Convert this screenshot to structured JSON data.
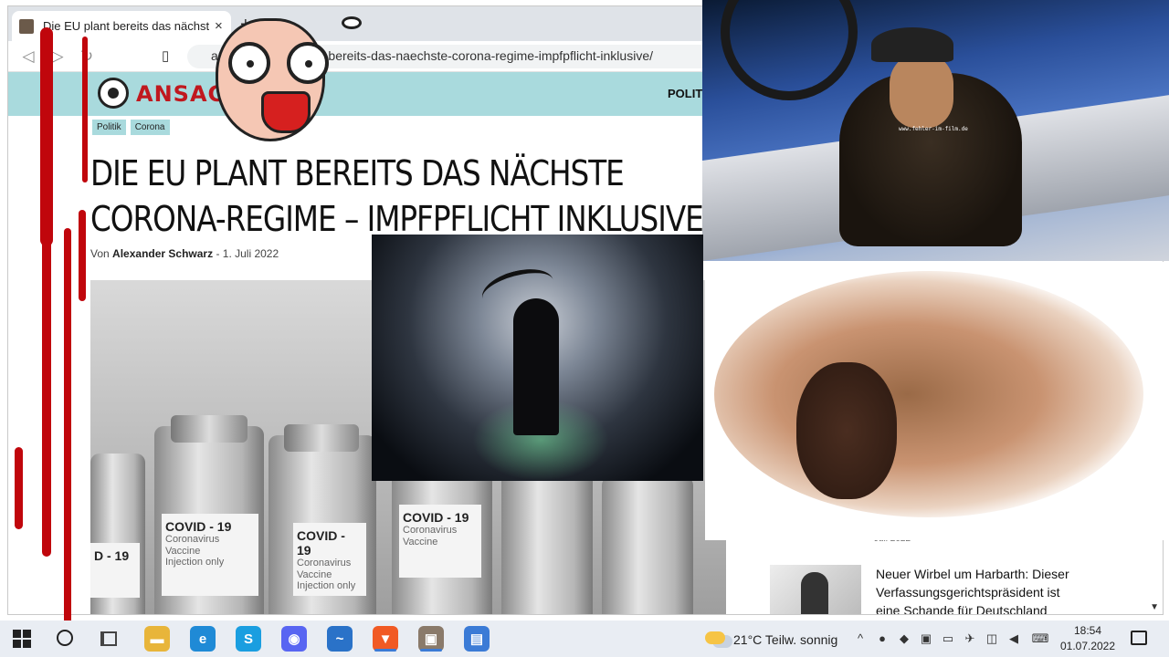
{
  "browser": {
    "tab_title": "Die EU plant bereits das nächste C",
    "new_tab": "+",
    "close": "×",
    "url": "anso...e/politik/plant-bereits-das-naechste-corona-regime-impfpflicht-inklusive/"
  },
  "site": {
    "logo_text": "ANSAGE",
    "nav_label": "POLITIK"
  },
  "article": {
    "tags": [
      "Politik",
      "Corona"
    ],
    "headline_line1": "DIE EU PLANT BEREITS DAS NÄCHSTE",
    "headline_line2": "CORONA-REGIME – IMPFPFLICHT INKLUSIVE",
    "byline_prefix": "Von",
    "author": "Alexander Schwarz",
    "date_sep": "-",
    "date": "1. Juli 2022",
    "vial_labels": [
      {
        "big": "COVID - 19",
        "small1": "Coronavirus",
        "small2": "Vaccine",
        "small3": "Injection only"
      },
      {
        "big": "COVID - 19",
        "small1": "Coronavirus",
        "small2": "Vaccine",
        "small3": "Injection only"
      },
      {
        "big": "COVID - 19",
        "small1": "Coronavirus",
        "small2": "Vaccine",
        "small3": ""
      },
      {
        "big": "D - 19",
        "small1": "",
        "small2": "",
        "small3": ""
      }
    ]
  },
  "sidebar": {
    "date_partial": "Juli 2022",
    "article_title": "Neuer Wirbel um Harbarth: Dieser Verfassungsgerichtspräsident ist eine Schande für Deutschland"
  },
  "overlays": {
    "watermark": "www.fehler-im-film.de"
  },
  "taskbar": {
    "apps": [
      {
        "icon": "file-explorer-icon",
        "color": "#e8b53a",
        "glyph": "▬"
      },
      {
        "icon": "edge-icon",
        "color": "#1f8ad6",
        "glyph": "e"
      },
      {
        "icon": "skype-icon",
        "color": "#1a9ee0",
        "glyph": "S"
      },
      {
        "icon": "discord-icon",
        "color": "#5865f2",
        "glyph": "◉"
      },
      {
        "icon": "thunderbird-icon",
        "color": "#2a72c8",
        "glyph": "~"
      },
      {
        "icon": "brave-icon",
        "color": "#f15a24",
        "glyph": "▼"
      },
      {
        "icon": "image-viewer-icon",
        "color": "#8a7a6a",
        "glyph": "▣"
      },
      {
        "icon": "document-app-icon",
        "color": "#3b7bd6",
        "glyph": "▤"
      }
    ],
    "temperature": "21°C",
    "weather": "Teilw. sonnig",
    "time": "18:54",
    "date": "01.07.2022"
  }
}
